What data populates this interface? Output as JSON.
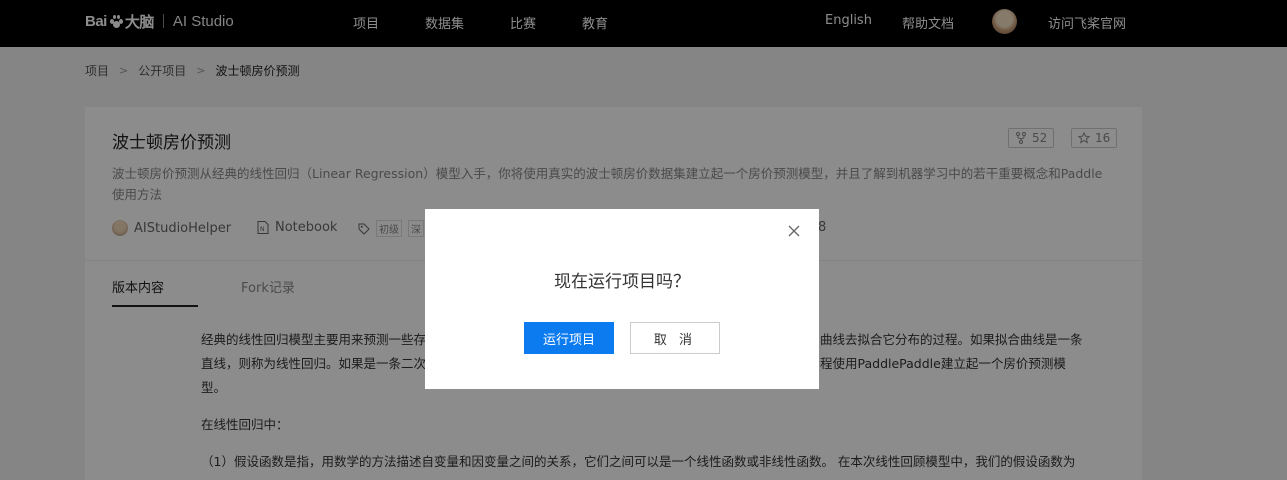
{
  "nav": {
    "logo_baidu": "Bai",
    "logo_daao": "大脑",
    "logo_studio": "AI Studio",
    "links": [
      "项目",
      "数据集",
      "比赛",
      "教育"
    ],
    "english": "English",
    "help": "帮助文档",
    "visit": "访问飞桨官网"
  },
  "breadcrumb": {
    "items": [
      "项目",
      "公开项目",
      "波士顿房价预测"
    ]
  },
  "project": {
    "title": "波士顿房价预测",
    "description": "波士顿房价预测从经典的线性回归（Linear Regression）模型入手，你将使用真实的波士顿房价数据集建立起一个房价预测模型，并且了解到机器学习中的若干重要概念和Paddle使用方法",
    "forks": "52",
    "stars": "16",
    "author": "AIStudioHelper",
    "type": "Notebook",
    "tags": [
      "初级",
      "深"
    ],
    "date_fragment": "8"
  },
  "tabs": {
    "active": "版本内容",
    "other": "Fork记录"
  },
  "body": {
    "line1a": "经典的线性回归模型主要用来预测一些存",
    "line1b": "曲线去拟合它分布的过程。如果拟合曲线是一条",
    "line2a": "直线，则称为线性回归。如果是一条二次",
    "line2b": "程使用PaddlePaddle建立起一个房价预测模",
    "line3": "型。",
    "line4": "在线性回归中：",
    "line5": "（1）假设函数是指，用数学的方法描述自变量和因变量之间的关系，它们之间可以是一个线性函数或非线性函数。 在本次线性回顾模型中，我们的假设函数为"
  },
  "modal": {
    "title": "现在运行项目吗？",
    "run_label": "运行项目",
    "cancel_label": "取 消"
  },
  "colors": {
    "primary": "#0c7bf0",
    "topbar": "#000000"
  }
}
